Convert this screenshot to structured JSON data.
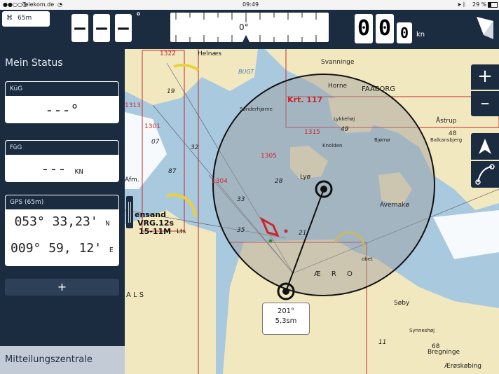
{
  "statusbar": {
    "carrier": "Telekom.de",
    "time": "09:49",
    "battery": "29 %"
  },
  "topbar": {
    "gps_label": "65m",
    "course_digits": [
      "–",
      "–",
      "–"
    ],
    "degree_symbol": "°",
    "compass_readout": "0°",
    "speed_digits": [
      "0",
      "0",
      "0"
    ],
    "speed_unit": "kn"
  },
  "sidebar": {
    "title": "Mein Status",
    "kug": {
      "label": "KüG",
      "value": "---°"
    },
    "fug": {
      "label": "FüG",
      "value": "---",
      "unit": "KN"
    },
    "gps": {
      "label": "GPS (65m)",
      "lat": "053° 33,23'",
      "lat_dir": "N",
      "lon": "009° 59, 12'",
      "lon_dir": "E"
    },
    "add_label": "+",
    "footer": "Mitteilungszentrale"
  },
  "zoom": {
    "in": "+",
    "out": "–"
  },
  "map": {
    "measure": {
      "bearing": "201°",
      "distance": "5,3sm"
    },
    "places": {
      "helnaes": "Helnæs",
      "svanninge": "Svanninge",
      "horne": "Horne",
      "faaborg": "FAABORG",
      "lyo": "Lyø",
      "avernako": "Avernakø",
      "sonderhjorne": "Sønderhjørne",
      "bjorno": "Bjørnø",
      "knolden": "Knolden",
      "lykkehoj": "Lykkehøj",
      "astrup": "Åstrup",
      "balkansbjerg": "Balkansbjerg",
      "soby": "Søby",
      "synneshoj": "Synneshøj",
      "bregninge": "Bregninge",
      "aeroskobing": "Ærøskøbing",
      "aero": "Æ R O",
      "als": "A  L  S",
      "bugt": "BUGT",
      "lts": "Lts",
      "sand": "ensand",
      "vrg": "VRG.12s",
      "range": "15-11M",
      "afm": "Afm.",
      "krt": "Krt. 117",
      "kobet": "obet"
    },
    "lights": [
      "1322",
      "1313",
      "1301",
      "1315",
      "1305",
      "1304"
    ],
    "depths": [
      "19",
      "32",
      "33",
      "35",
      "28",
      "49",
      "48",
      "68",
      "11",
      "07",
      "87",
      "21"
    ]
  },
  "colors": {
    "panel": "#1b2b40",
    "land": "#f2e8bf",
    "water_shallow": "#a9c9df",
    "water_deep": "#ffffff",
    "chart_red": "#c8282d"
  }
}
